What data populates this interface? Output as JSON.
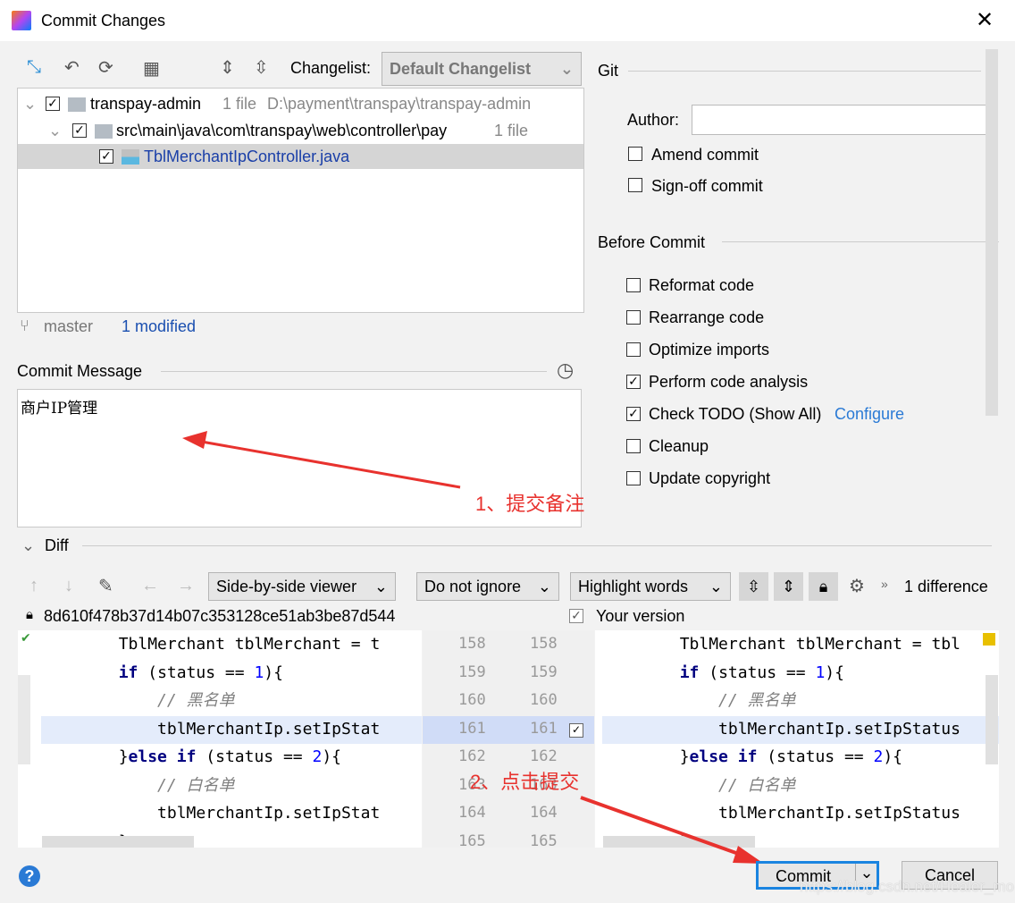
{
  "window": {
    "title": "Commit Changes",
    "close_icon": "close-icon"
  },
  "toolbar": {
    "changelist_label": "Changelist:",
    "changelist_value": "Default Changelist"
  },
  "tree": [
    {
      "name": "transpay-admin",
      "count": "1 file",
      "path": "D:\\payment\\transpay\\transpay-admin"
    },
    {
      "name": "src\\main\\java\\com\\transpay\\web\\controller\\pay",
      "count": "1 file"
    },
    {
      "name": "TblMerchantIpController.java"
    }
  ],
  "status": {
    "branch": "master",
    "modified": "1 modified"
  },
  "commit_message": {
    "label": "Commit Message",
    "value": "商户IP管理"
  },
  "git": {
    "section": "Git",
    "author_label": "Author:",
    "author_value": "",
    "amend": "Amend commit",
    "signoff": "Sign-off commit"
  },
  "before_commit": {
    "section": "Before Commit",
    "options": [
      {
        "label": "Reformat code",
        "checked": false
      },
      {
        "label": "Rearrange code",
        "checked": false
      },
      {
        "label": "Optimize imports",
        "checked": false
      },
      {
        "label": "Perform code analysis",
        "checked": true
      },
      {
        "label": "Check TODO (Show All)",
        "checked": true
      },
      {
        "label": "Cleanup",
        "checked": false
      },
      {
        "label": "Update copyright",
        "checked": false
      }
    ],
    "configure": "Configure"
  },
  "diff": {
    "label": "Diff",
    "viewer": "Side-by-side viewer",
    "ignore": "Do not ignore",
    "highlight": "Highlight words",
    "count": "1 difference",
    "hash": "8d610f478b37d14b07c353128ce51ab3be87d544",
    "your_version": "Your version",
    "line_numbers": [
      "158",
      "159",
      "160",
      "161",
      "162",
      "163",
      "164",
      "165"
    ],
    "left_lines": [
      "        TblMerchant tblMerchant = t",
      "        if (status == 1){",
      "            // 黑名单",
      "            tblMerchantIp.setIpStat",
      "        }else if (status == 2){",
      "            // 白名单",
      "            tblMerchantIp.setIpStat",
      "        }"
    ],
    "right_lines": [
      "        TblMerchant tblMerchant = tbl",
      "        if (status == 1){",
      "            // 黑名单",
      "            tblMerchantIp.setIpStatus",
      "        }else if (status == 2){",
      "            // 白名单",
      "            tblMerchantIp.setIpStatus",
      "        }"
    ]
  },
  "annotations": {
    "note1": "1、提交备注",
    "note2": "2、点击提交",
    "watermark": "https://blog.csdn.net/Healer_mo"
  },
  "buttons": {
    "commit": "Commit",
    "cancel": "Cancel",
    "help": "?"
  },
  "colors": {
    "accent": "#1a73e8",
    "annotation": "#e8322e",
    "selected_row": "#d5d5d5",
    "changed_line": "#e4ecfb"
  }
}
